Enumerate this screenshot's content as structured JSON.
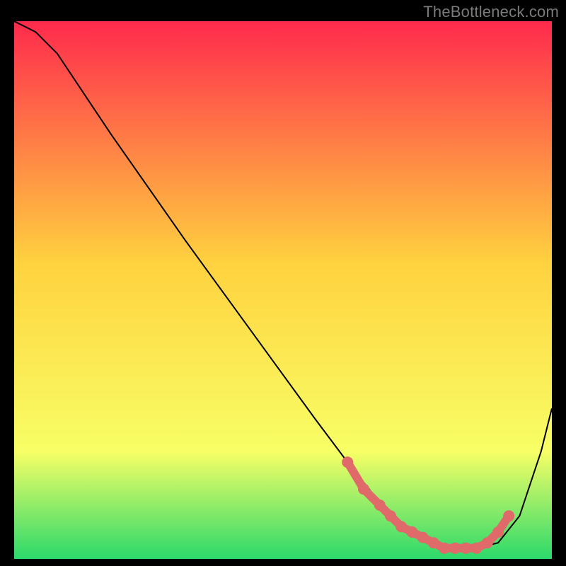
{
  "attribution": "TheBottleneck.com",
  "colors": {
    "bg": "#000000",
    "gradient_top": "#ff2a4d",
    "gradient_mid": "#ffd23f",
    "gradient_low": "#f8ff66",
    "gradient_bottom": "#2bd96b",
    "curve": "#000000",
    "beads": "#e06a6a",
    "attribution_text": "#7a7a7a"
  },
  "chart_data": {
    "type": "line",
    "title": "",
    "xlabel": "",
    "ylabel": "",
    "xlim": [
      0,
      100
    ],
    "ylim": [
      0,
      100
    ],
    "grid": false,
    "legend": false,
    "series": [
      {
        "name": "bottleneck-curve",
        "x": [
          0,
          4,
          8,
          12,
          18,
          25,
          32,
          40,
          48,
          56,
          62,
          66,
          70,
          74,
          78,
          82,
          86,
          90,
          94,
          98,
          100
        ],
        "y": [
          100,
          98,
          94,
          88,
          79,
          69,
          59,
          48,
          37,
          26,
          18,
          13,
          8,
          5,
          3,
          2,
          2,
          3,
          8,
          20,
          28
        ]
      }
    ],
    "highlight": {
      "name": "optimal-zone-beads",
      "x": [
        62,
        65,
        68,
        70,
        72,
        74,
        76,
        78,
        80,
        82,
        84,
        86,
        88,
        90,
        92
      ],
      "y": [
        18,
        13,
        10,
        8,
        6,
        5,
        4,
        3,
        2,
        2,
        2,
        2,
        3,
        5,
        8
      ]
    }
  }
}
